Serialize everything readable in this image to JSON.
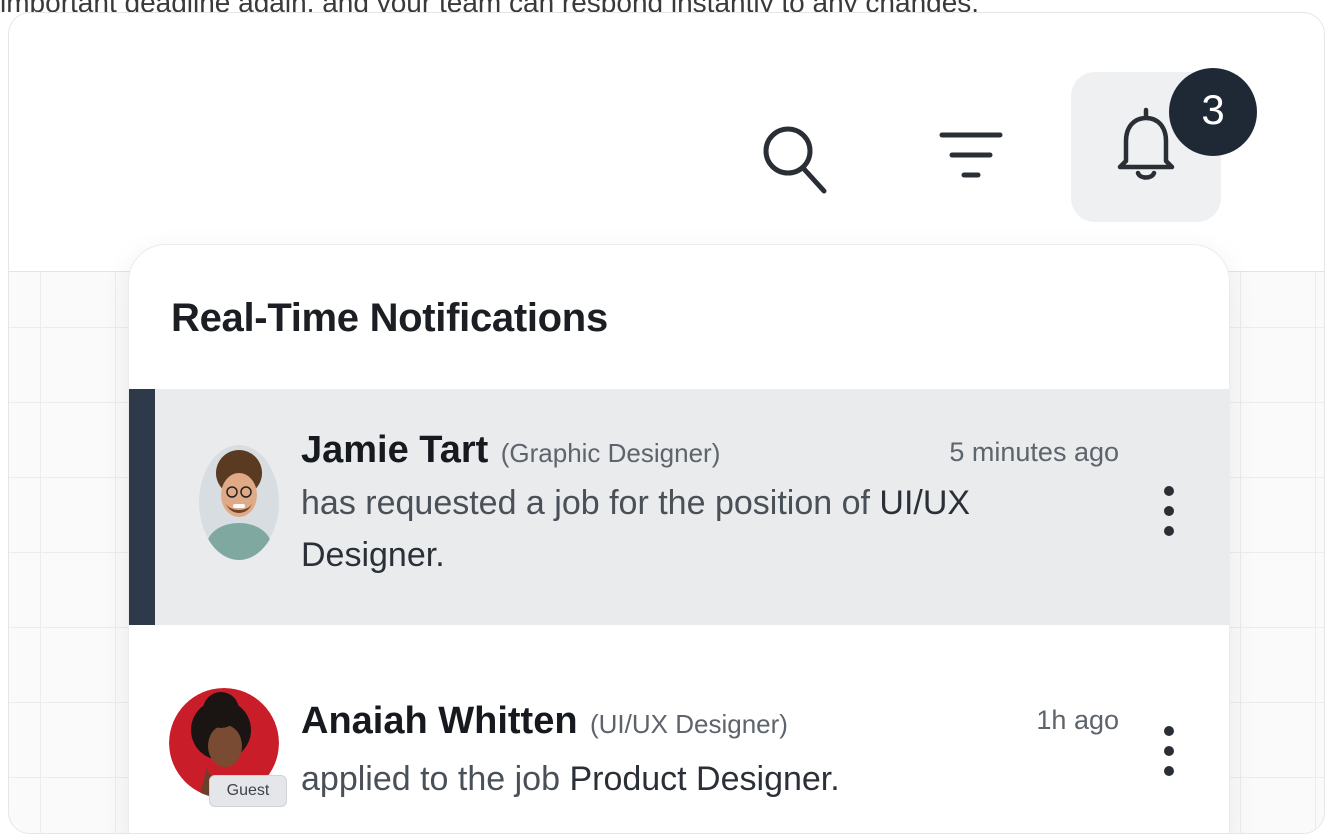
{
  "caption": "important deadline again, and your team can respond instantly to any changes.",
  "toolbar": {
    "search_icon": "search-icon",
    "filter_icon": "filter-icon",
    "bell_icon": "bell-icon",
    "notification_count": "3"
  },
  "panel": {
    "title": "Real-Time Notifications",
    "items": [
      {
        "name": "Jamie Tart",
        "role": "(Graphic Designer)",
        "time": "5 minutes ago",
        "message_prefix": "has requested a job for the position of",
        "message_emphasis": "UI/UX Designer.",
        "active": true
      },
      {
        "name": "Anaiah Whitten",
        "role": "(UI/UX Designer)",
        "time": "1h ago",
        "message_prefix": "applied to the job",
        "message_emphasis": "Product Designer.",
        "badge": "Guest",
        "active": false
      }
    ]
  },
  "colors": {
    "accent_bar": "#2e3949",
    "badge_bg": "#1f2936",
    "active_row_bg": "#e9ebed"
  }
}
